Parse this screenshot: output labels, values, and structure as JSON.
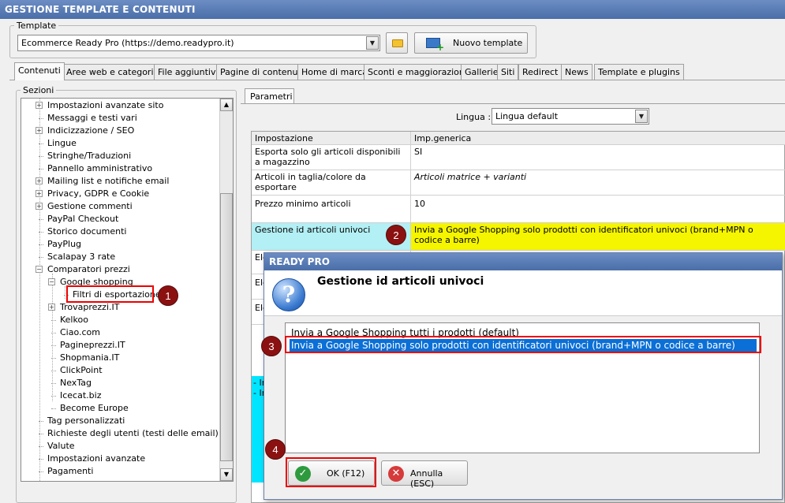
{
  "app": {
    "title": "GESTIONE TEMPLATE E CONTENUTI"
  },
  "template": {
    "group_label": "Template",
    "selected": "Ecommerce Ready Pro (https://demo.readypro.it)",
    "new_button": "Nuovo template"
  },
  "tabs": [
    {
      "label": "Contenuti",
      "active": true
    },
    {
      "label": "Aree web e categorie"
    },
    {
      "label": "File aggiuntivi"
    },
    {
      "label": "Pagine di contenuti"
    },
    {
      "label": "Home di marca"
    },
    {
      "label": "Sconti e maggiorazioni"
    },
    {
      "label": "Gallerie"
    },
    {
      "label": "Siti"
    },
    {
      "label": "Redirect"
    },
    {
      "label": "News"
    },
    {
      "label": "Template e plugins"
    }
  ],
  "sections": {
    "label": "Sezioni",
    "items": [
      "Impostazioni avanzate sito",
      "Messaggi e testi vari",
      "Indicizzazione / SEO",
      "Lingue",
      "Stringhe/Traduzioni",
      "Pannello amministrativo",
      "Mailing list e notifiche email",
      "Privacy, GDPR e Cookie",
      "Gestione commenti",
      "PayPal Checkout",
      "Storico documenti",
      "PayPlug",
      "Scalapay 3 rate",
      "Comparatori prezzi",
      "Google shopping",
      "Filtri di esportazione",
      "Trovaprezzi.IT",
      "Kelkoo",
      "Ciao.com",
      "Pagineprezzi.IT",
      "Shopmania.IT",
      "ClickPoint",
      "NexTag",
      "Icecat.biz",
      "Become Europe",
      "Tag personalizzati",
      "Richieste degli utenti (testi delle email)",
      "Valute",
      "Impostazioni avanzate",
      "Pagamenti"
    ]
  },
  "params": {
    "tab": "Parametri",
    "lingua_label": "Lingua :",
    "lingua_value": "Lingua default",
    "headers": [
      "Impostazione",
      "Imp.generica"
    ],
    "rows": [
      [
        "Esporta solo gli articoli disponibili a magazzino",
        "SI"
      ],
      [
        "Articoli in taglia/colore da esportare",
        "Articoli matrice + varianti"
      ],
      [
        "Prezzo minimo articoli",
        "10"
      ],
      [
        "Gestione id articoli univoci",
        "Invia a Google Shopping solo prodotti con identificatori univoci (brand+MPN o codice a barre)"
      ],
      [
        "Ele",
        ""
      ],
      [
        "Ele",
        ""
      ],
      [
        "Ele",
        ""
      ]
    ],
    "info_lines": [
      "- In",
      "- In"
    ]
  },
  "dialog": {
    "title": "READY PRO",
    "heading": "Gestione id articoli univoci",
    "options": [
      "Invia a Google Shopping tutti i prodotti (default)",
      "Invia a Google Shopping solo prodotti con identificatori univoci (brand+MPN o codice a barre)"
    ],
    "selected_index": 1,
    "ok_label": "OK (F12)",
    "cancel_label": "Annulla (ESC)"
  },
  "steps": [
    "1",
    "2",
    "3",
    "4"
  ],
  "colors": {
    "accent": "#4a6ea8",
    "selection": "#0a6fd6",
    "highlight_yellow": "#f5f500",
    "highlight_cyan": "#b3f0f5",
    "step_marker": "#8b1111",
    "annotation_border": "#ee0000"
  }
}
